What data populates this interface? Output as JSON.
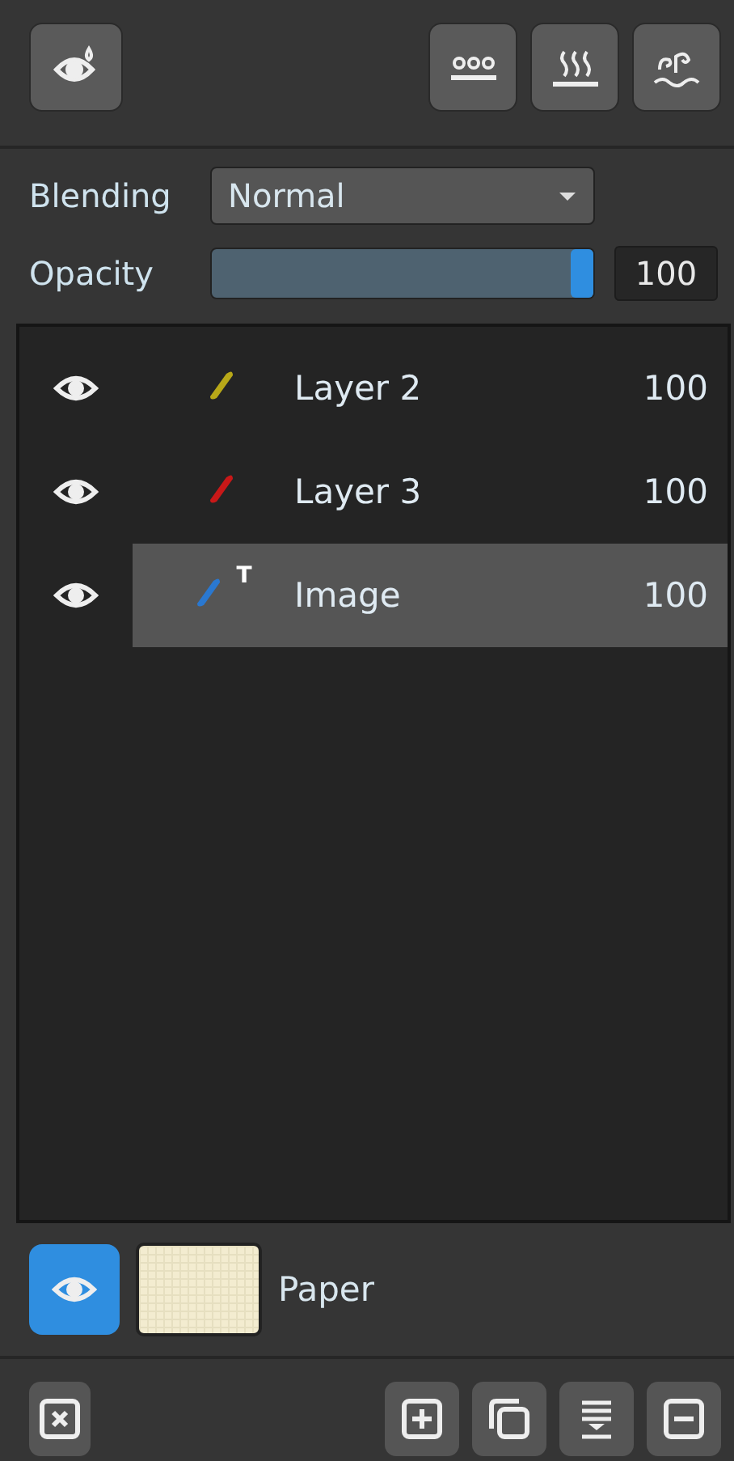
{
  "blending": {
    "label": "Blending",
    "value": "Normal"
  },
  "opacity": {
    "label": "Opacity",
    "level": 1,
    "value": "100"
  },
  "layers": [
    {
      "name": "Layer 2",
      "opacity": "100",
      "visible": true,
      "selected": false,
      "color": "#b8a818"
    },
    {
      "name": "Layer 3",
      "opacity": "100",
      "visible": true,
      "selected": false,
      "color": "#c81818"
    },
    {
      "name": "Image",
      "opacity": "100",
      "visible": true,
      "selected": true,
      "color": "#2a78d0",
      "badge": "T"
    }
  ],
  "paper": {
    "name": "Paper",
    "visible": true
  }
}
